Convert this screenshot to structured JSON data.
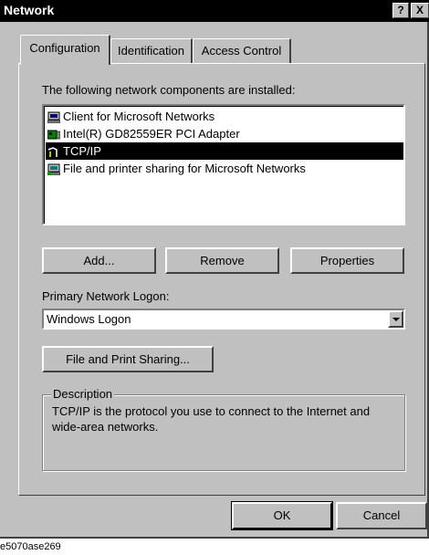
{
  "window": {
    "title": "Network",
    "help_button": "?",
    "close_button": "X"
  },
  "tabs": [
    {
      "label": "Configuration",
      "active": true
    },
    {
      "label": "Identification",
      "active": false
    },
    {
      "label": "Access Control",
      "active": false
    }
  ],
  "components": {
    "label": "The following network components are installed:",
    "items": [
      {
        "icon": "client-icon",
        "label": "Client for Microsoft Networks",
        "selected": false
      },
      {
        "icon": "adapter-icon",
        "label": "Intel(R) GD82559ER PCI Adapter",
        "selected": false
      },
      {
        "icon": "protocol-icon",
        "label": "TCP/IP",
        "selected": true
      },
      {
        "icon": "sharing-icon",
        "label": "File and printer sharing for Microsoft Networks",
        "selected": false
      }
    ]
  },
  "buttons": {
    "add": "Add...",
    "remove": "Remove",
    "properties": "Properties",
    "file_print_sharing": "File and Print Sharing...",
    "ok": "OK",
    "cancel": "Cancel"
  },
  "logon": {
    "label": "Primary Network Logon:",
    "value": "Windows Logon"
  },
  "description": {
    "legend": "Description",
    "text": "TCP/IP is the protocol you use to connect to the Internet and wide-area networks."
  },
  "caption": "e5070ase269"
}
